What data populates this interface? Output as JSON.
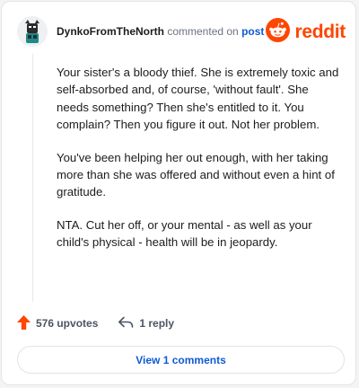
{
  "comment": {
    "username": "DynkoFromTheNorth",
    "action_text": "commented on",
    "post_link": "post",
    "paragraphs": [
      "Your sister's a bloody thief. She is extremely toxic and self-absorbed and, of course, 'without fault'. She needs something? Then she's entitled to it. You complain? Then you figure it out. Not her problem.",
      "You've been helping her out enough, with her taking more than she was offered and without even a hint of gratitude.",
      "NTA. Cut her off, or your mental - as well as your child's physical - health will be in jeopardy."
    ]
  },
  "brand": {
    "name": "reddit",
    "color": "#ff4500"
  },
  "actions": {
    "upvotes_label": "576 upvotes",
    "reply_label": "1 reply",
    "view_comments_label": "View 1 comments"
  },
  "icons": {
    "upvote": "upvote-arrow-icon",
    "reply": "reply-arrow-icon",
    "logo": "reddit-snoo-icon",
    "avatar": "user-avatar"
  }
}
